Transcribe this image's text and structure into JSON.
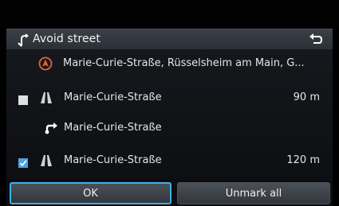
{
  "header": {
    "title": "Avoid street",
    "detour_icon": "detour-arrow-icon",
    "back_icon": "back-arrow-icon"
  },
  "list": {
    "destination": {
      "icon": "destination-pin-icon",
      "label": "Marie-Curie-Straße, Rüsselsheim am Main, G..."
    },
    "rows": [
      {
        "checked": false,
        "icon": "road-icon",
        "label": "Marie-Curie-Straße",
        "distance": "90 m"
      },
      {
        "icon": "turn-right-icon",
        "label": "Marie-Curie-Straße"
      },
      {
        "checked": true,
        "icon": "road-icon",
        "label": "Marie-Curie-Straße",
        "distance": "120 m"
      }
    ]
  },
  "buttons": {
    "ok": "OK",
    "unmark_all": "Unmark all"
  },
  "colors": {
    "accent": "#3fb0e8",
    "destination": "#e8603a",
    "checkbox_checked": "#4aa3e0",
    "checkbox_unchecked": "#e0e0e0"
  }
}
